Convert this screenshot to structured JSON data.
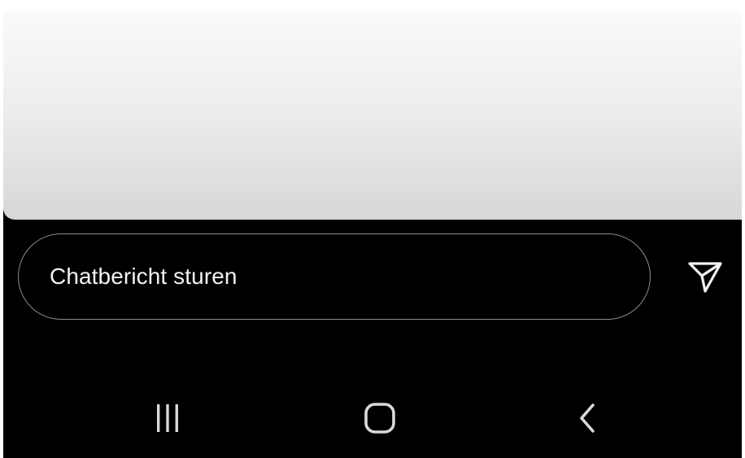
{
  "chat": {
    "placeholder": "Chatbericht sturen"
  },
  "icons": {
    "send": "send-icon",
    "recents": "recents-icon",
    "home": "home-icon",
    "back": "back-icon"
  },
  "colors": {
    "background": "#000000",
    "content_top": "#fafafa",
    "content_bottom": "#d7d7d7",
    "input_border": "#8d8d8d",
    "text": "#f2f2f2"
  }
}
